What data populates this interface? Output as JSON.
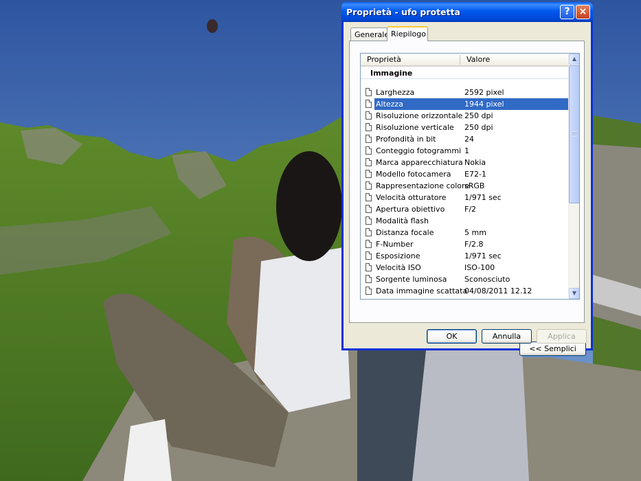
{
  "window": {
    "title": "Proprietà - ufo protetta"
  },
  "caption_buttons": {
    "help": "?",
    "close": "×"
  },
  "tabs": [
    "Generale",
    "Riepilogo"
  ],
  "list": {
    "headers": {
      "property": "Proprietà",
      "value": "Valore"
    },
    "group": "Immagine",
    "rows": [
      {
        "name": "Larghezza",
        "value": "2592 pixel"
      },
      {
        "name": "Altezza",
        "value": "1944 pixel",
        "selected": true
      },
      {
        "name": "Risoluzione orizzontale",
        "value": "250 dpi"
      },
      {
        "name": "Risoluzione verticale",
        "value": "250 dpi"
      },
      {
        "name": "Profondità in bit",
        "value": "24"
      },
      {
        "name": "Conteggio fotogrammi",
        "value": "1"
      },
      {
        "name": "Marca apparecchiatura",
        "value": "Nokia"
      },
      {
        "name": "Modello fotocamera",
        "value": "E72-1"
      },
      {
        "name": "Rappresentazione colore",
        "value": "sRGB"
      },
      {
        "name": "Velocità otturatore",
        "value": "1/971 sec"
      },
      {
        "name": "Apertura obiettivo",
        "value": "F/2"
      },
      {
        "name": "Modalità flash",
        "value": ""
      },
      {
        "name": "Distanza focale",
        "value": "5 mm"
      },
      {
        "name": "F-Number",
        "value": "F/2.8"
      },
      {
        "name": "Esposizione",
        "value": "1/971 sec"
      },
      {
        "name": "Velocità ISO",
        "value": "ISO-100"
      },
      {
        "name": "Sorgente luminosa",
        "value": "Sconosciuto"
      },
      {
        "name": "Data immagine scattata",
        "value": "04/08/2011 12.12"
      }
    ]
  },
  "buttons": {
    "simple": "<< Semplici",
    "ok": "OK",
    "cancel": "Annulla",
    "apply": "Applica"
  },
  "colors": {
    "selection": "#316ac5",
    "titlebar": "#0058ee",
    "dialog_bg": "#ece9d8"
  }
}
